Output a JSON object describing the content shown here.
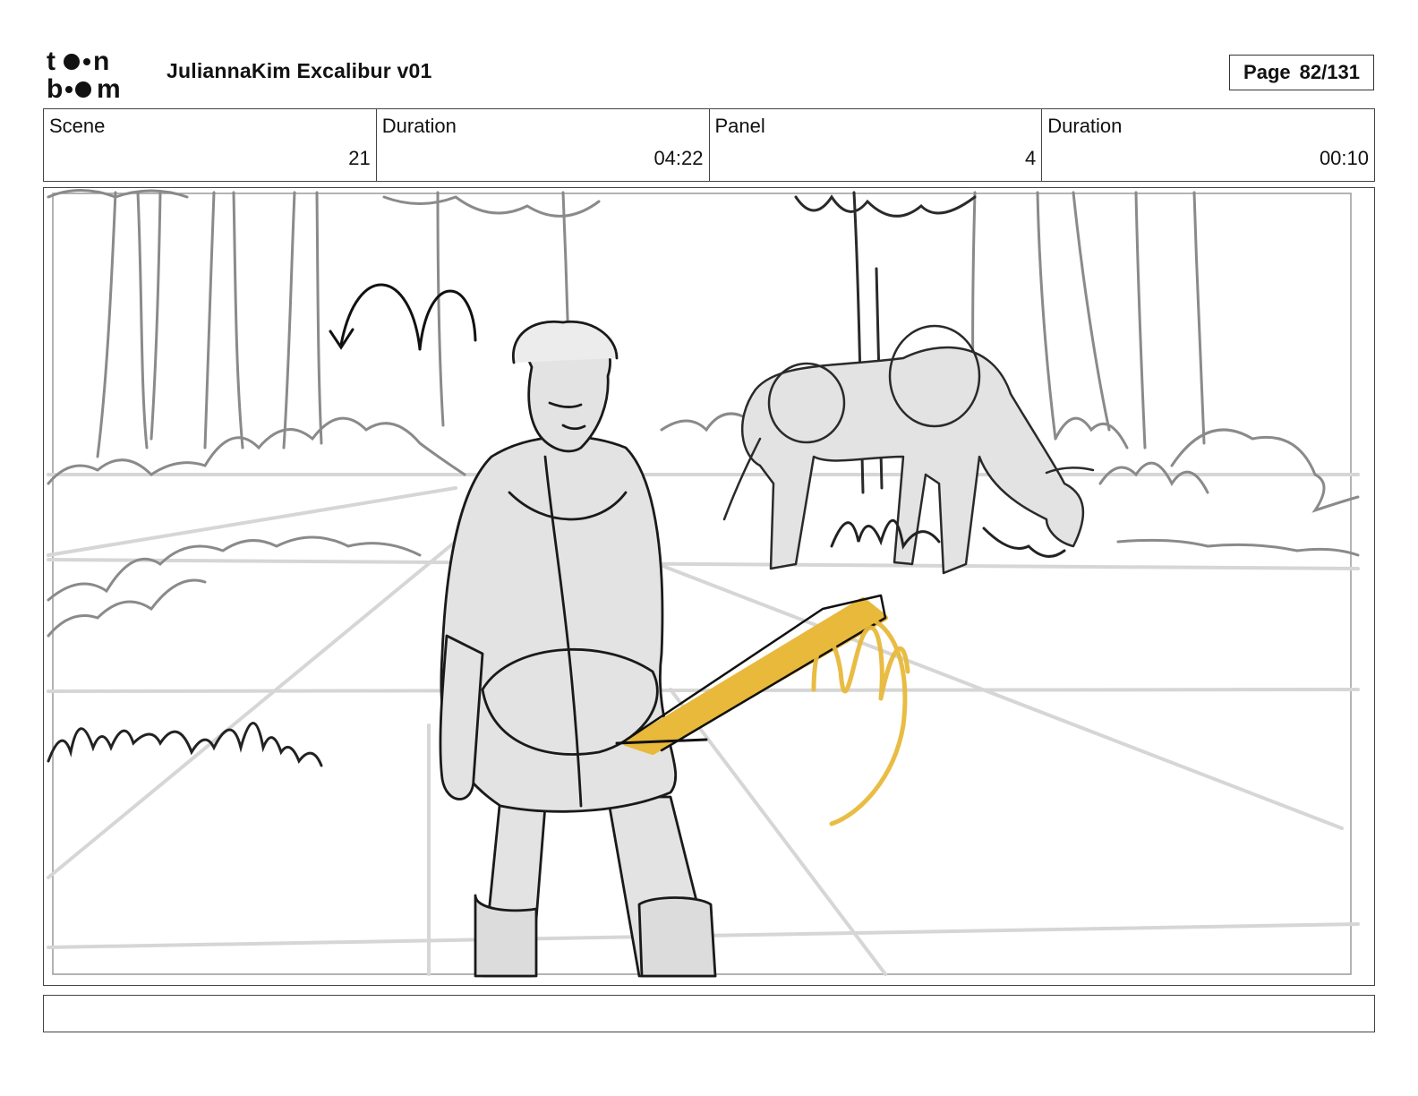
{
  "header": {
    "logo_text": "toon boom",
    "project_title": "JuliannaKim Excalibur v01",
    "page_label": "Page",
    "page_number": "82/131"
  },
  "info": {
    "scene_label": "Scene",
    "scene_value": "21",
    "scene_duration_label": "Duration",
    "scene_duration_value": "04:22",
    "panel_label": "Panel",
    "panel_value": "4",
    "panel_duration_label": "Duration",
    "panel_duration_value": "00:10"
  },
  "colors": {
    "sword_highlight": "#e8b93a",
    "sketch_fill": "#e3e3e3",
    "line_dark": "#1a1a1a",
    "line_grey": "#8a8a8a"
  },
  "caption": {
    "text": ""
  }
}
